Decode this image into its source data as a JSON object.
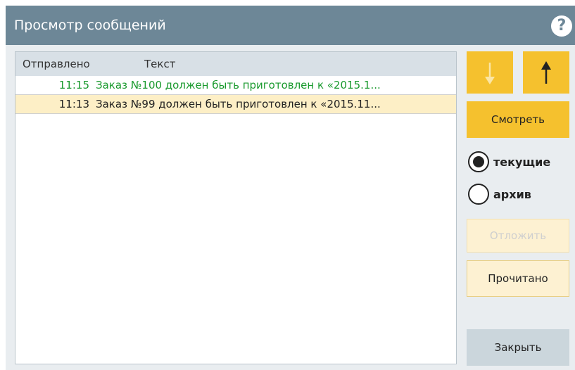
{
  "window": {
    "title": "Просмотр сообщений"
  },
  "list": {
    "columns": {
      "sent": "Отправлено",
      "text": "Текст"
    },
    "rows": [
      {
        "time": "11:15",
        "text": "Заказ №100 должен быть приготовлен к «2015.1...",
        "status": "unread"
      },
      {
        "time": "11:13",
        "text": "Заказ №99 должен быть приготовлен к «2015.11...",
        "status": "selected"
      }
    ]
  },
  "buttons": {
    "down_icon": "arrow-down-icon",
    "up_icon": "arrow-up-icon",
    "view": "Смотреть",
    "defer": "Отложить",
    "read": "Прочитано",
    "close": "Закрыть"
  },
  "filter": {
    "current": "текущие",
    "archive": "архив",
    "selected": "current"
  },
  "colors": {
    "titlebar": "#6d8797",
    "accent": "#f5c12e",
    "unread_text": "#1a9a2e",
    "selected_row": "#fdefc6"
  }
}
